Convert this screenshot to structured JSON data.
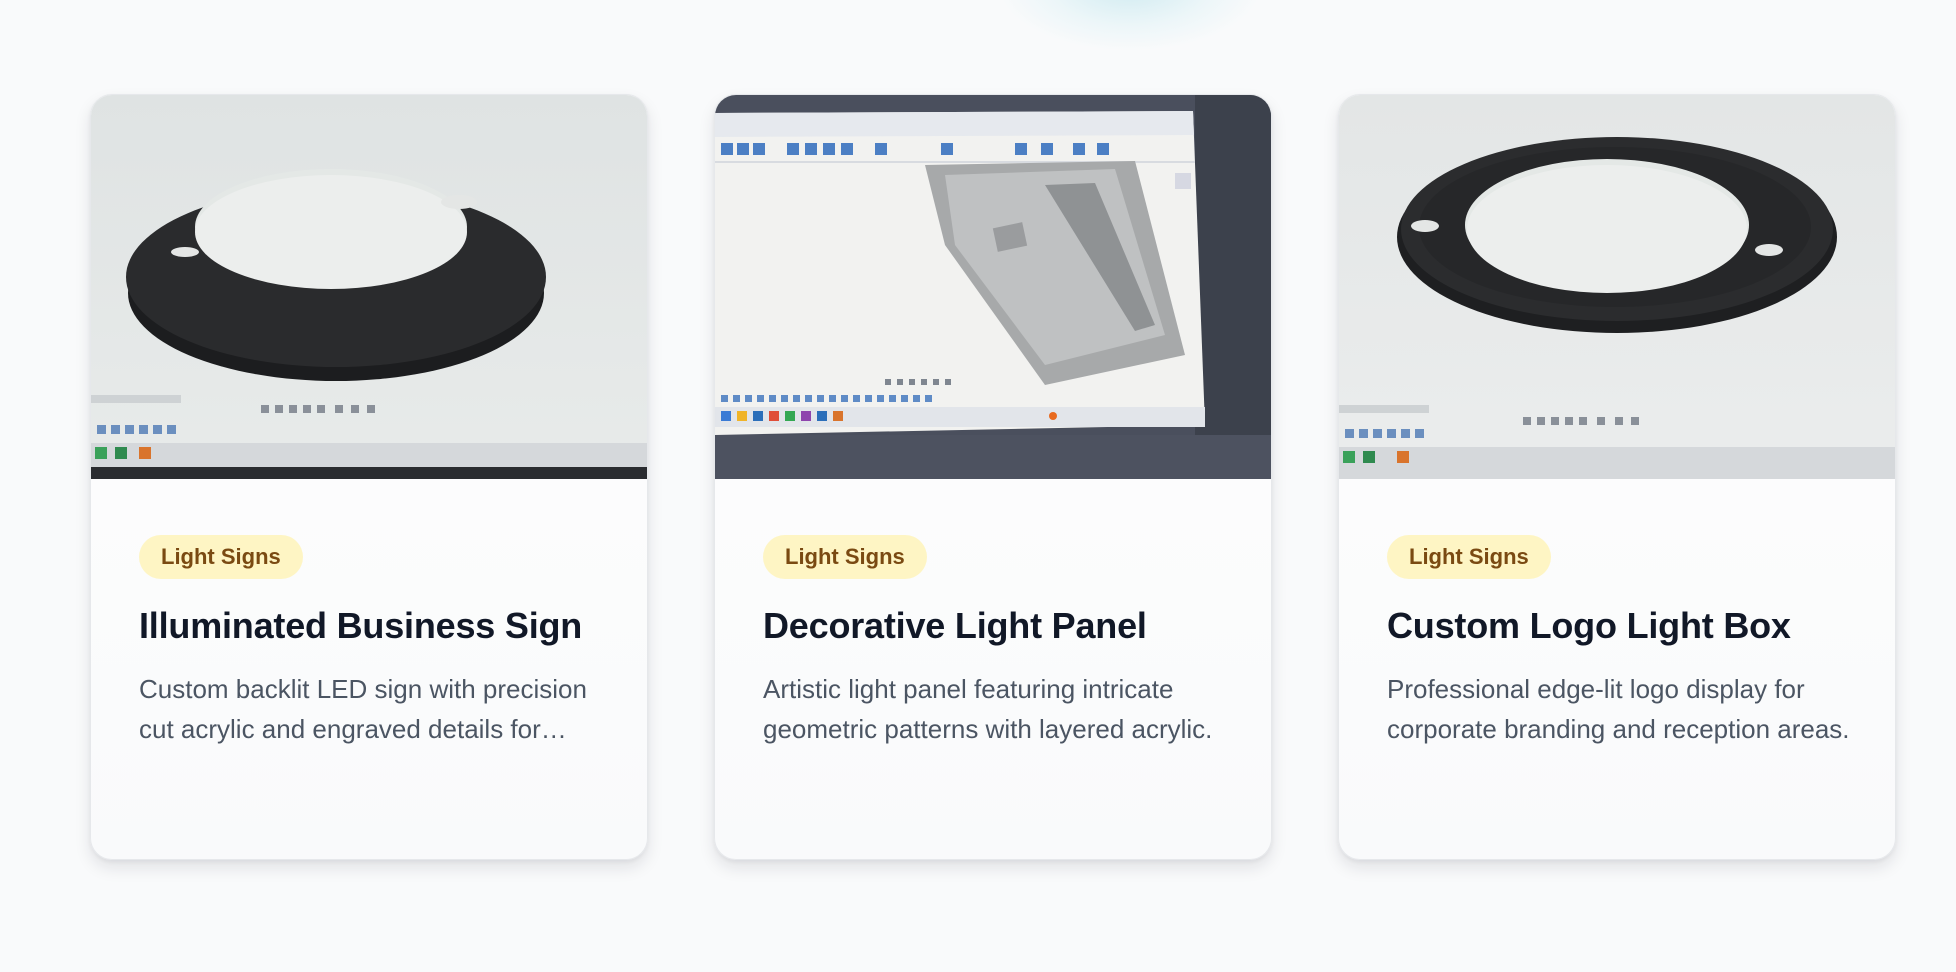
{
  "cards": [
    {
      "tag": "Light Signs",
      "title": "Illuminated Business Sign",
      "description": "Custom backlit LED sign with precision cut acrylic and engraved details for storefront display.",
      "image": "photo of black ring CAD render on monitor"
    },
    {
      "tag": "Light Signs",
      "title": "Decorative Light Panel",
      "description": "Artistic light panel featuring intricate geometric patterns with layered acrylic.",
      "image": "photo of CAD software on monitor"
    },
    {
      "tag": "Light Signs",
      "title": "Custom Logo Light Box",
      "description": "Professional edge-lit logo display for corporate branding and reception areas.",
      "image": "photo of black ring CAD render on monitor"
    }
  ],
  "colors": {
    "tag_bg": "#fef5c4",
    "tag_text": "#7a4a12",
    "title": "#111827",
    "description": "#4b5563"
  }
}
